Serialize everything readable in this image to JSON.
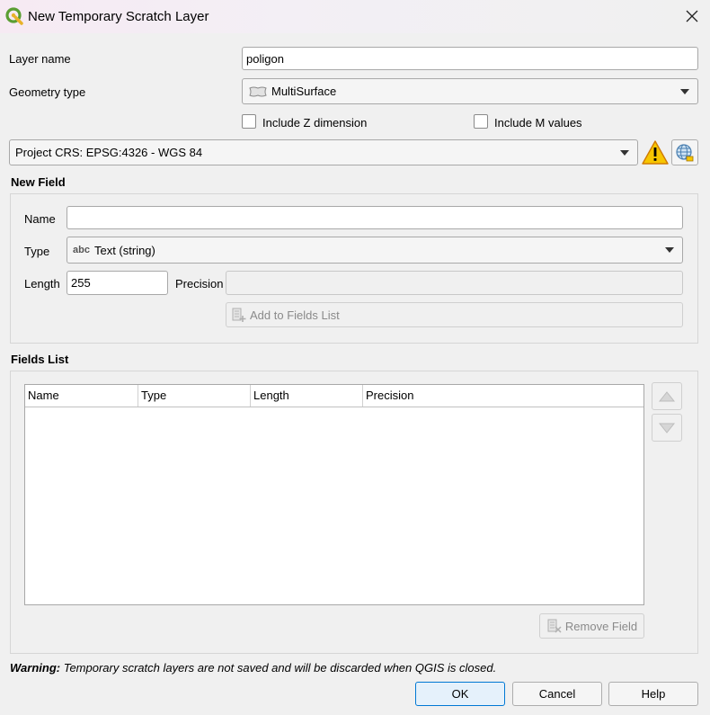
{
  "window": {
    "title": "New Temporary Scratch Layer"
  },
  "form": {
    "layer_name_label": "Layer name",
    "layer_name_value": "poligon",
    "geometry_type_label": "Geometry type",
    "geometry_type_value": "MultiSurface",
    "include_z_label": "Include Z dimension",
    "include_z_checked": false,
    "include_m_label": "Include M values",
    "include_m_checked": false,
    "crs_value": "Project CRS: EPSG:4326 - WGS 84"
  },
  "new_field": {
    "title": "New Field",
    "name_label": "Name",
    "name_value": "",
    "type_label": "Type",
    "type_icon_text": "abc",
    "type_value": "Text (string)",
    "length_label": "Length",
    "length_value": "255",
    "precision_label": "Precision",
    "precision_value": "",
    "add_button": "Add to Fields List"
  },
  "fields_list": {
    "title": "Fields List",
    "columns": [
      "Name",
      "Type",
      "Length",
      "Precision"
    ],
    "rows": [],
    "remove_button": "Remove Field"
  },
  "warning": {
    "label": "Warning:",
    "text": " Temporary scratch layers are not saved and will be discarded when QGIS is closed."
  },
  "buttons": {
    "ok": "OK",
    "cancel": "Cancel",
    "help": "Help"
  },
  "colors": {
    "accent": "#0078d4",
    "qgis_green": "#5a9e32",
    "warning_yellow": "#f7c600"
  }
}
